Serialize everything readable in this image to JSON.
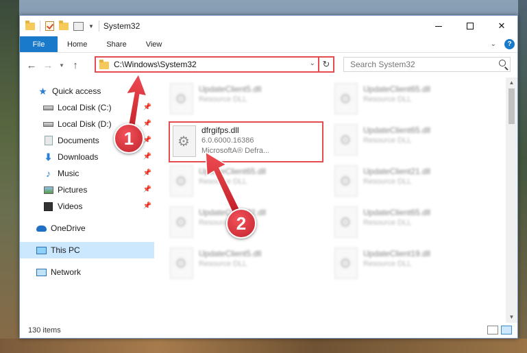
{
  "window": {
    "title": "System32",
    "controls": {
      "minimize": "minimize-icon",
      "maximize": "maximize-icon",
      "close": "✕"
    }
  },
  "ribbon": {
    "tabs": [
      "File",
      "Home",
      "Share",
      "View"
    ],
    "help": "?"
  },
  "address": {
    "path": "C:\\Windows\\System32",
    "search_placeholder": "Search System32"
  },
  "sidebar": {
    "quick_access": "Quick access",
    "items": [
      {
        "label": "Local Disk (C:)",
        "icon": "drive-icon"
      },
      {
        "label": "Local Disk (D:)",
        "icon": "drive-icon"
      },
      {
        "label": "Documents",
        "icon": "documents-icon"
      },
      {
        "label": "Downloads",
        "icon": "downloads-icon"
      },
      {
        "label": "Music",
        "icon": "music-icon"
      },
      {
        "label": "Pictures",
        "icon": "pictures-icon"
      },
      {
        "label": "Videos",
        "icon": "videos-icon"
      }
    ],
    "onedrive": "OneDrive",
    "this_pc": "This PC",
    "network": "Network"
  },
  "files": [
    {
      "name": "UpdateClient5.dll",
      "meta": "Resource DLL"
    },
    {
      "name": "UpdateClient65.dll",
      "meta": "Resource DLL"
    },
    {
      "name": "UpdateClient65.dll",
      "meta": "Resource DLL"
    },
    {
      "name": "UpdateClient65.dll",
      "meta": "Resource DLL"
    },
    {
      "name": "UpdateClient21.dll",
      "meta": "Resource DLL"
    },
    {
      "name": "UpdateClient42.dll",
      "meta": "Resource DLL"
    },
    {
      "name": "UpdateClient65.dll",
      "meta": "Resource DLL"
    },
    {
      "name": "UpdateClient5.dll",
      "meta": "Resource DLL"
    },
    {
      "name": "UpdateClient19.dll",
      "meta": "Resource DLL"
    }
  ],
  "highlighted_file": {
    "name": "dfrgifps.dll",
    "version": "6.0.6000.16386",
    "description": "MicrosoftA® Defra..."
  },
  "status": {
    "count": "130 items"
  },
  "callouts": [
    "1",
    "2"
  ],
  "colors": {
    "accent": "#1979ca",
    "highlight": "#e34b4f",
    "selected": "#cce8ff"
  }
}
